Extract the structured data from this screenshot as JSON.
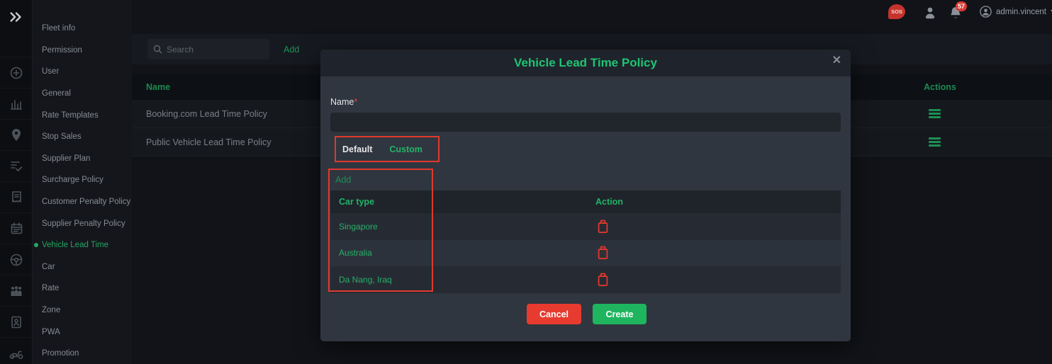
{
  "sidebar": {
    "items": [
      {
        "label": "Fleet info"
      },
      {
        "label": "Permission"
      },
      {
        "label": "User"
      },
      {
        "label": "General"
      },
      {
        "label": "Rate Templates"
      },
      {
        "label": "Stop Sales"
      },
      {
        "label": "Supplier Plan"
      },
      {
        "label": "Surcharge Policy"
      },
      {
        "label": "Customer Penalty Policy"
      },
      {
        "label": "Supplier Penalty Policy"
      },
      {
        "label": "Vehicle Lead Time",
        "active": true
      },
      {
        "label": "Car"
      },
      {
        "label": "Rate"
      },
      {
        "label": "Zone"
      },
      {
        "label": "PWA"
      },
      {
        "label": "Promotion"
      }
    ],
    "rail_icons": [
      "double-chevron-right",
      "plus-circle",
      "bar-chart",
      "location-pin",
      "document-check",
      "receipt",
      "calendar",
      "steering-wheel",
      "people-group",
      "id-card",
      "scooter"
    ]
  },
  "topbar": {
    "sos_label": "SOS",
    "notification_count": "57",
    "username": "admin.vincent",
    "icons": [
      "sos-badge",
      "person",
      "bell",
      "avatar",
      "caret-down"
    ]
  },
  "content": {
    "search_placeholder": "Search",
    "add_label": "Add",
    "table": {
      "name_header": "Name",
      "actions_header": "Actions",
      "rows": [
        {
          "name": "Booking.com Lead Time Policy"
        },
        {
          "name": "Public Vehicle Lead Time Policy"
        }
      ]
    }
  },
  "modal": {
    "title": "Vehicle Lead Time Policy",
    "close_glyph": "✕",
    "name_label": "Name",
    "required_mark": "*",
    "name_value": "",
    "tabs": {
      "default": "Default",
      "custom": "Custom",
      "active": "Custom"
    },
    "add_label": "Add",
    "table": {
      "car_type_header": "Car type",
      "action_header": "Action",
      "rows": [
        {
          "car_type": "Singapore"
        },
        {
          "car_type": "Australia"
        },
        {
          "car_type": "Da Nang, Iraq"
        }
      ]
    },
    "cancel_label": "Cancel",
    "create_label": "Create"
  },
  "colors": {
    "accent_green": "#1fb368",
    "title_green": "#1ec473",
    "danger_red": "#e73b30",
    "annotation_red": "#e0392c",
    "badge_red": "#d93a31",
    "create_green": "#1fb55f"
  }
}
